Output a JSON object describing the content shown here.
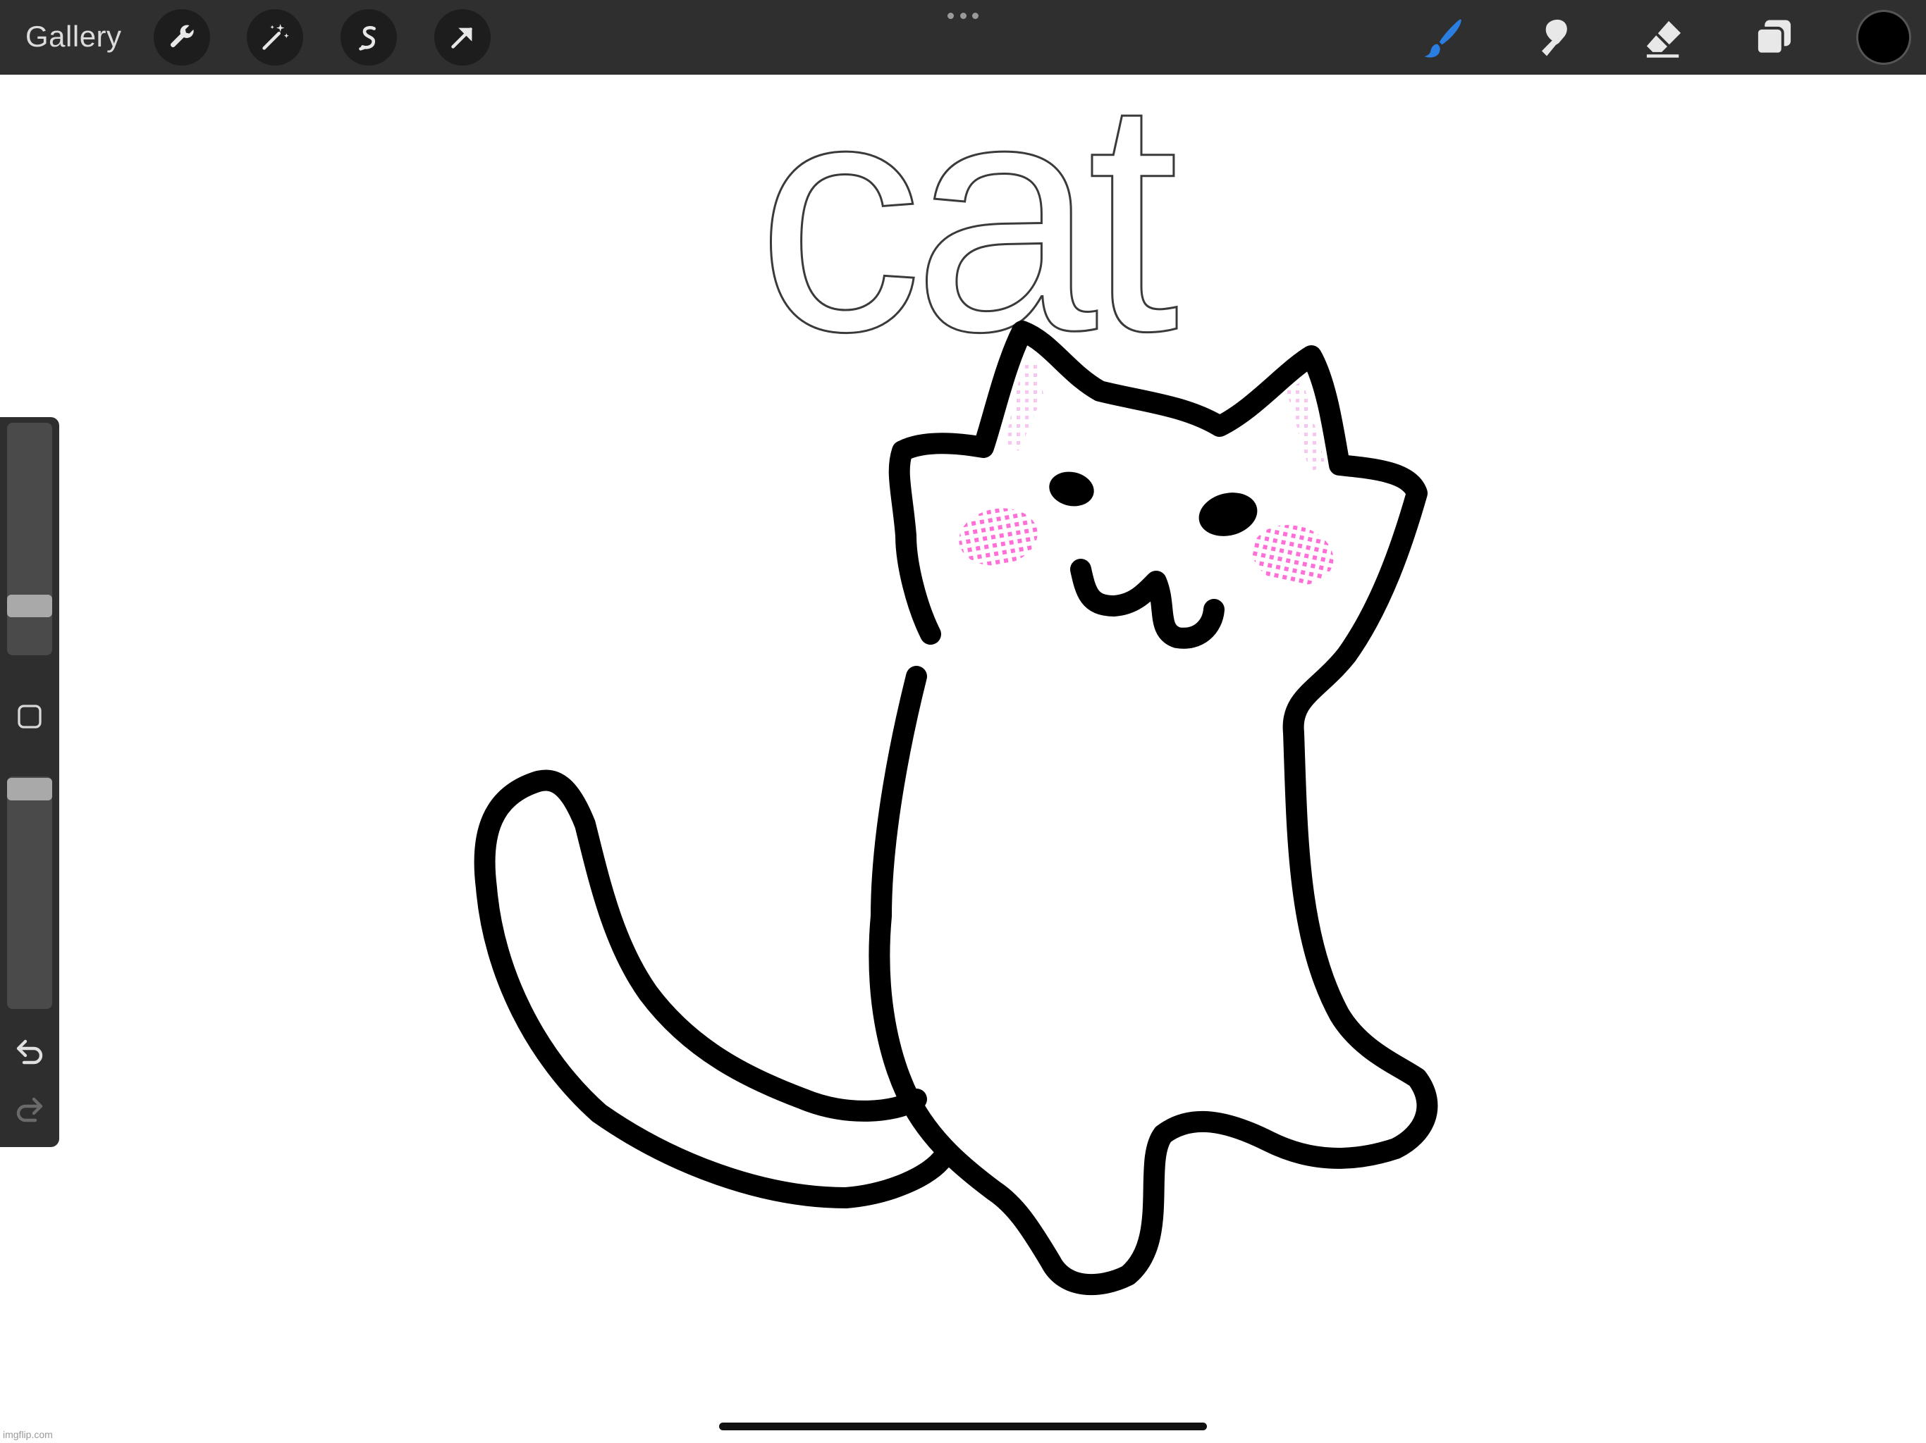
{
  "toolbar": {
    "gallery_label": "Gallery",
    "left_tools": [
      "wrench-icon",
      "magic-wand-icon",
      "selection-s-icon",
      "arrow-transform-icon"
    ],
    "right_tools": [
      "brush-icon",
      "smudge-icon",
      "eraser-icon",
      "layers-icon"
    ],
    "active_tool": "brush-icon",
    "brush_color": "#2a7de1",
    "current_color": "#000000"
  },
  "sidebar": {
    "brush_size_level": 0.22,
    "brush_opacity_level": 0.95
  },
  "canvas": {
    "text_layer": "cat",
    "blush_color": "#ff6fd8",
    "stroke_color": "#000000"
  },
  "watermark": "imgflip.com"
}
